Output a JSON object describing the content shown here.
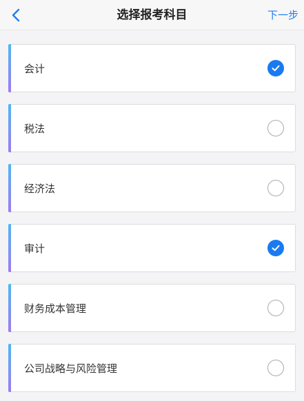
{
  "header": {
    "title": "选择报考科目",
    "next_label": "下一步"
  },
  "subjects": [
    {
      "label": "会计",
      "selected": true
    },
    {
      "label": "税法",
      "selected": false
    },
    {
      "label": "经济法",
      "selected": false
    },
    {
      "label": "审计",
      "selected": true
    },
    {
      "label": "财务成本管理",
      "selected": false
    },
    {
      "label": "公司战略与风险管理",
      "selected": false
    }
  ],
  "colors": {
    "accent": "#1a7af0",
    "bar_top": "#4fb7f3",
    "bar_bottom": "#9f7bf0"
  }
}
